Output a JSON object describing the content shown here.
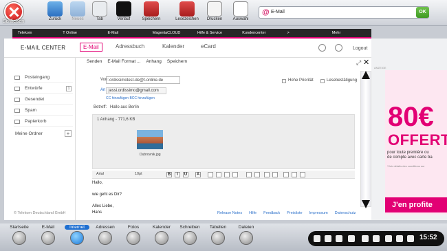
{
  "toolbar": {
    "close_label": "Schließen",
    "buttons": [
      "Zurück",
      "Neues",
      "Tab",
      "Verlauf",
      "Speichern",
      "Lesezeichen",
      "Drucken",
      "Auswahl"
    ],
    "url": "E-Mail",
    "go_label": "OK"
  },
  "nav": [
    "Telekom",
    "T Online",
    "E-Mail",
    "MagentaCLOUD",
    "Hilfe & Service",
    "Kundencenter",
    ">",
    "Mehr"
  ],
  "header": {
    "brand": "E-MAIL CENTER",
    "tabs": [
      "E-Mail",
      "Adressbuch",
      "Kalender",
      "eCard"
    ],
    "logout": "Logout"
  },
  "sidebar": {
    "items": [
      "Posteingang",
      "Entwürfe",
      "Gesendet",
      "Spam",
      "Papierkorb"
    ],
    "draft_count": "1",
    "my_folders": "Meine Ordner"
  },
  "compose": {
    "actions": [
      "Senden",
      "E-Mail Format ...",
      "Anhang",
      "Speichern"
    ],
    "from_label": "Von:",
    "from_value": "ordissimotest-de@t-online.de",
    "to_label": "An:",
    "to_value": "jessi.ordissimo@gmail.com",
    "priority": "Hohe Priorität",
    "read_receipt": "Lesebestätigung",
    "cc_links": "CC hinzufügen  BCC hinzufügen",
    "subject_label": "Betreff:",
    "subject_value": "Hallo aus Berlin",
    "attach_title": "1 Anhang - 771,6 KB",
    "attach_file": "Dubrovnik.jpg",
    "font": "Arial",
    "size": "10pt",
    "body_lines": [
      "Hallo,",
      "",
      "wie geht es Dir?",
      "",
      "Alles Liebe,",
      "Hans"
    ]
  },
  "footer": {
    "copyright": "© Telekom Deutschland GmbH",
    "links": [
      "Release Notes",
      "Hilfe",
      "Feedback",
      "Preisliste",
      "Impressum",
      "Datenschutz"
    ]
  },
  "ad": {
    "big": "80€",
    "offer": "OFFERT",
    "line1": "pour toute première ou",
    "line2": "de compte avec carte ba",
    "fine": "*Voir détails des conditions sur",
    "cta": "J'en profite",
    "tag": "ANZEIGE"
  },
  "taskbar": {
    "items": [
      "Startseite",
      "E-Mail",
      "Internet",
      "Adressen",
      "Fotos",
      "Kalender",
      "Schreiben",
      "Tabellen",
      "Dateien"
    ],
    "time": "15:52"
  }
}
